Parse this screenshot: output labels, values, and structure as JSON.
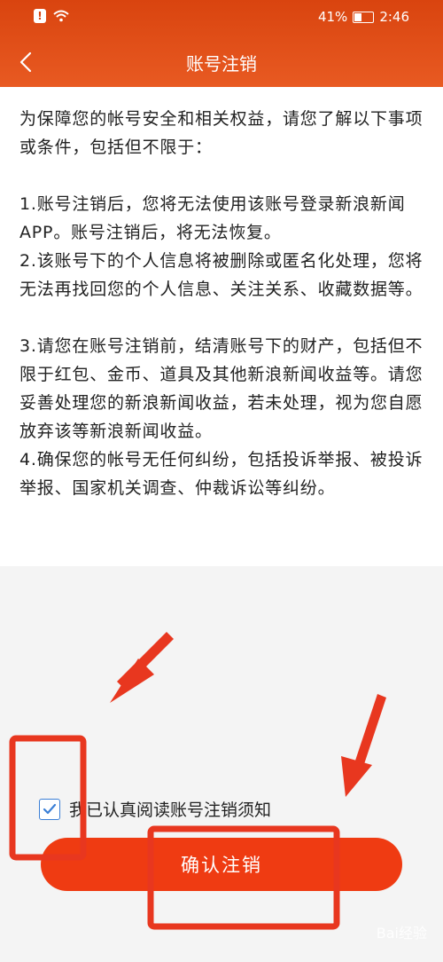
{
  "status_bar": {
    "battery": "41%",
    "time": "2:46"
  },
  "navbar": {
    "title": "账号注销",
    "back_icon": "chevron-left-icon"
  },
  "notice": {
    "intro": "为保障您的帐号安全和相关权益，请您了解以下事项或条件，包括但不限于：",
    "items": [
      "1.账号注销后，您将无法使用该账号登录新浪新闻APP。账号注销后，将无法恢复。",
      "2.该账号下的个人信息将被删除或匿名化处理，您将无法再找回您的个人信息、关注关系、收藏数据等。",
      "3.请您在账号注销前，结清账号下的财产，包括但不限于红包、金币、道具及其他新浪新闻收益等。请您妥善处理您的新浪新闻收益，若未处理，视为您自愿放弃该等新浪新闻收益。",
      "4.确保您的帐号无任何纠纷，包括投诉举报、被投诉举报、国家机关调查、仲裁诉讼等纠纷。"
    ]
  },
  "agreement": {
    "checked": true,
    "label": "我已认真阅读账号注销须知"
  },
  "confirm_button": {
    "label": "确认注销"
  },
  "watermark": "Bai经验",
  "colors": {
    "header": "#e14c15",
    "button": "#ef3b12",
    "checkbox": "#3b7fd6",
    "annotation": "#e8371f"
  }
}
